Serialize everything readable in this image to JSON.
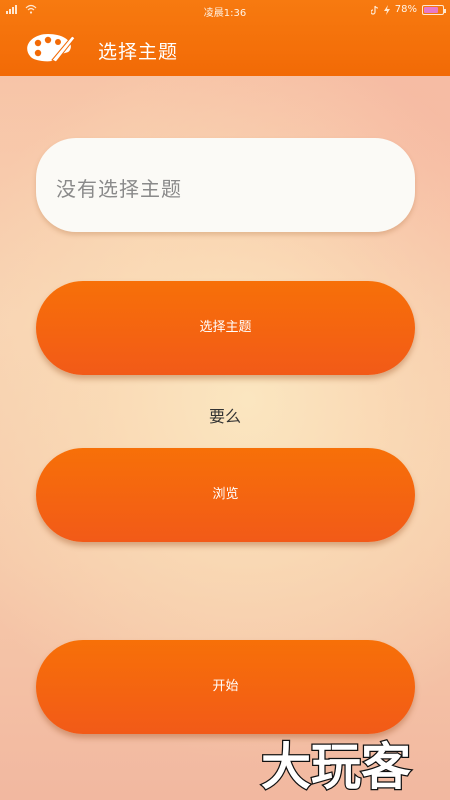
{
  "status_bar": {
    "time": "凌晨1:36",
    "battery": "78%",
    "battery_level": 0.78,
    "icons": [
      "signal-icon",
      "wifi-icon",
      "tiktok-icon",
      "charging-icon",
      "battery-icon"
    ]
  },
  "app_bar": {
    "title": "选择主题",
    "logo_icon": "palette-icon",
    "color": "#f26a06"
  },
  "topic_field": {
    "text": "没有选择主题"
  },
  "buttons": {
    "choose_topic": "选择主题",
    "or_text": "要么",
    "browse": "浏览",
    "start": "开始"
  },
  "watermark": {
    "text": "大玩客"
  },
  "colors": {
    "accent": "#f26a06",
    "button_top": "#f77008",
    "button_bottom": "#f25a18"
  }
}
